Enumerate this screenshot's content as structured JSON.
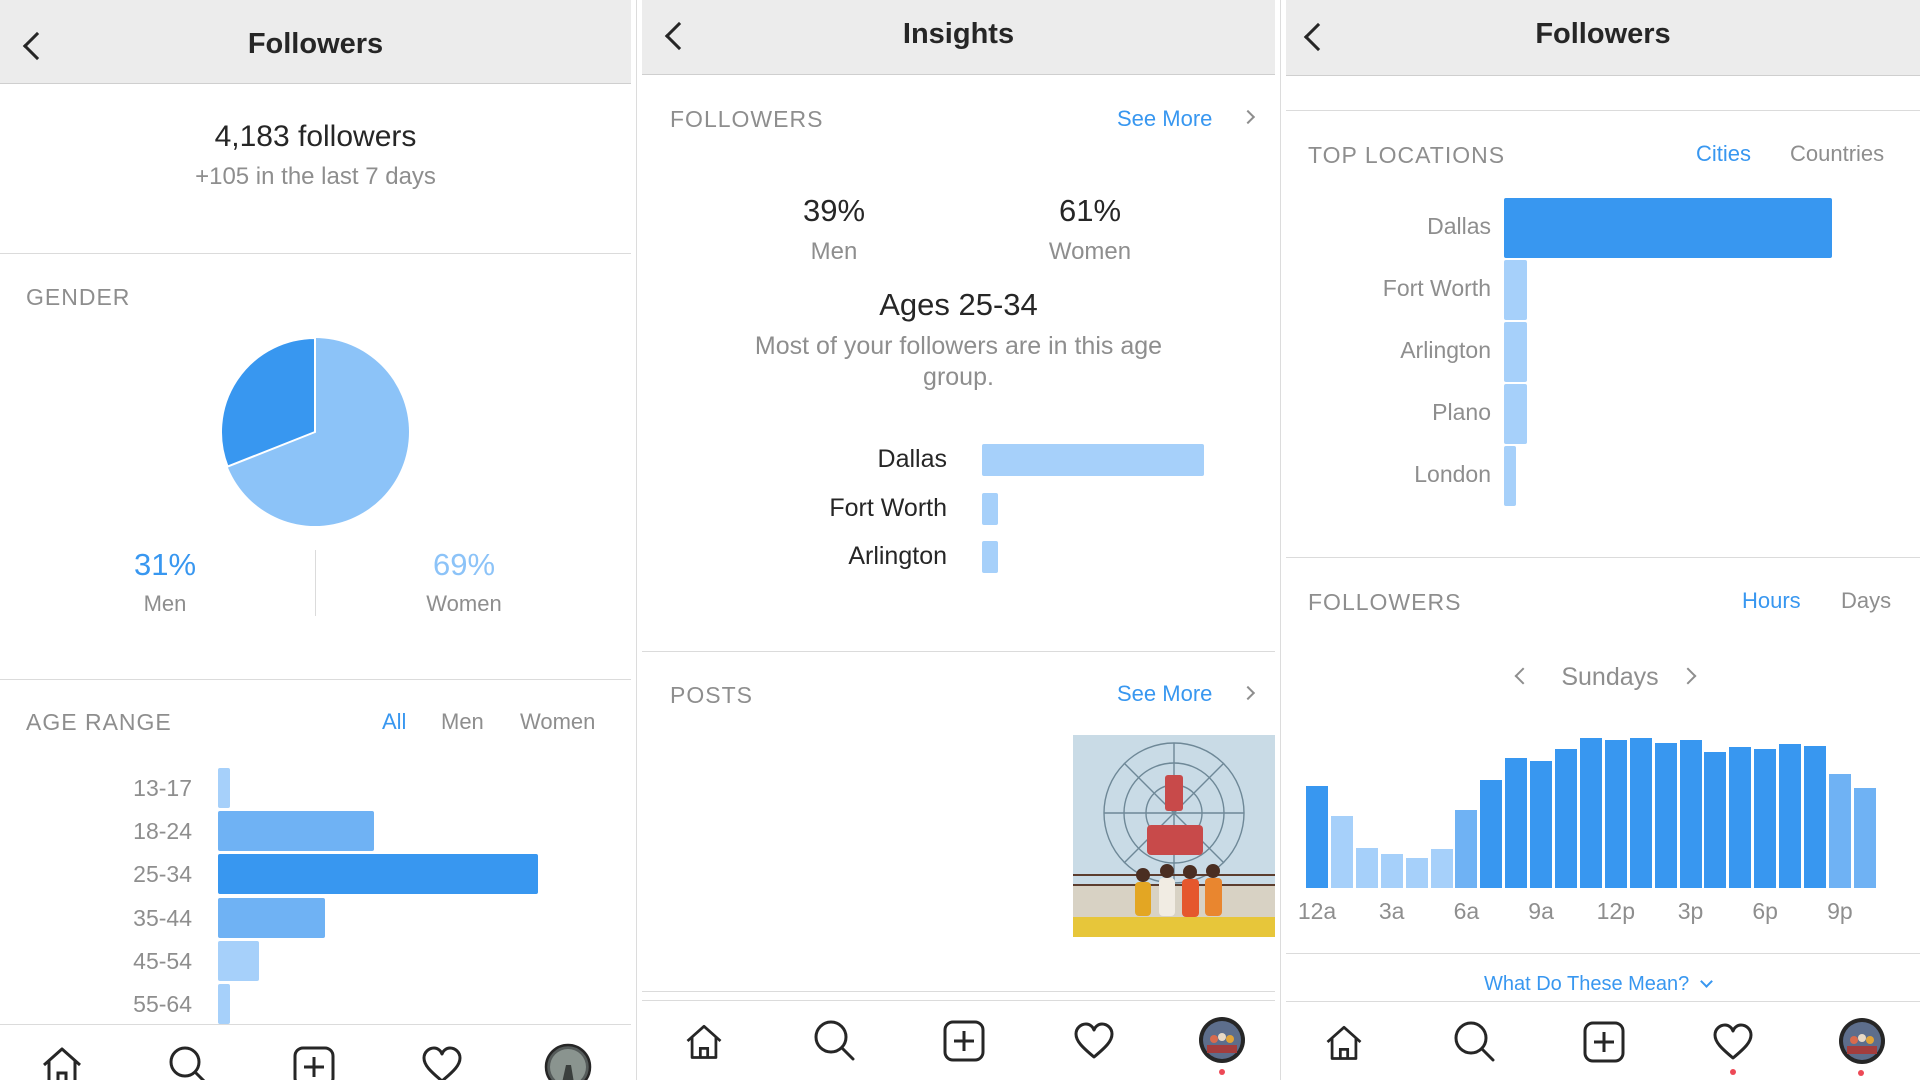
{
  "colors": {
    "accent": "#3897f0",
    "accent_light": "#8cc3f8",
    "bar_dark": "#3897f0",
    "bar_mid": "#6fb2f4",
    "bar_light": "#a6d0fa",
    "muted_text": "#8e8e8e",
    "notification": "#ed4956"
  },
  "followers_screen": {
    "title": "Followers",
    "total": "4,183 followers",
    "weekly_change": "+105 in the last 7 days",
    "gender": {
      "heading": "GENDER",
      "men_pct": "31%",
      "men_label": "Men",
      "women_pct": "69%",
      "women_label": "Women",
      "men_fraction": 0.31
    },
    "age_range": {
      "heading": "AGE RANGE",
      "filters": [
        "All",
        "Men",
        "Women"
      ],
      "active_filter": "All",
      "rows": [
        {
          "label": "13-17",
          "value": 1.5
        },
        {
          "label": "18-24",
          "value": 19
        },
        {
          "label": "25-34",
          "value": 39
        },
        {
          "label": "35-44",
          "value": 13
        },
        {
          "label": "45-54",
          "value": 5
        },
        {
          "label": "55-64",
          "value": 1.5
        }
      ]
    },
    "tabbar_icons": [
      "home-icon",
      "search-icon",
      "new-post-icon",
      "activity-heart-icon",
      "profile-avatar"
    ]
  },
  "insights_screen": {
    "title": "Insights",
    "followers_section": {
      "heading": "FOLLOWERS",
      "see_more": "See More",
      "men_pct": "39%",
      "men_label": "Men",
      "women_pct": "61%",
      "women_label": "Women",
      "age_headline": "Ages 25-34",
      "age_caption": "Most of your followers are in this age group.",
      "cities": [
        {
          "label": "Dallas",
          "value": 100
        },
        {
          "label": "Fort Worth",
          "value": 7
        },
        {
          "label": "Arlington",
          "value": 7
        }
      ]
    },
    "posts_section": {
      "heading": "POSTS",
      "see_more": "See More"
    }
  },
  "locations_screen": {
    "title": "Followers",
    "top_locations": {
      "heading": "TOP LOCATIONS",
      "tabs": [
        "Cities",
        "Countries"
      ],
      "active_tab": "Cities",
      "rows": [
        {
          "label": "Dallas",
          "value": 100
        },
        {
          "label": "Fort Worth",
          "value": 7
        },
        {
          "label": "Arlington",
          "value": 7
        },
        {
          "label": "Plano",
          "value": 7
        },
        {
          "label": "London",
          "value": 3.5
        }
      ]
    },
    "activity": {
      "heading": "FOLLOWERS",
      "tabs": [
        "Hours",
        "Days"
      ],
      "active_tab": "Hours",
      "day": "Sundays",
      "hour_ticks": [
        "12a",
        "3a",
        "6a",
        "9a",
        "12p",
        "3p",
        "6p",
        "9p"
      ],
      "hourly_values": [
        68,
        48,
        27,
        23,
        20,
        26,
        52,
        72,
        87,
        85,
        93,
        100,
        99,
        100,
        97,
        99,
        91,
        94,
        93,
        96,
        95,
        76,
        67
      ]
    },
    "help_link": "What Do These Mean?"
  }
}
